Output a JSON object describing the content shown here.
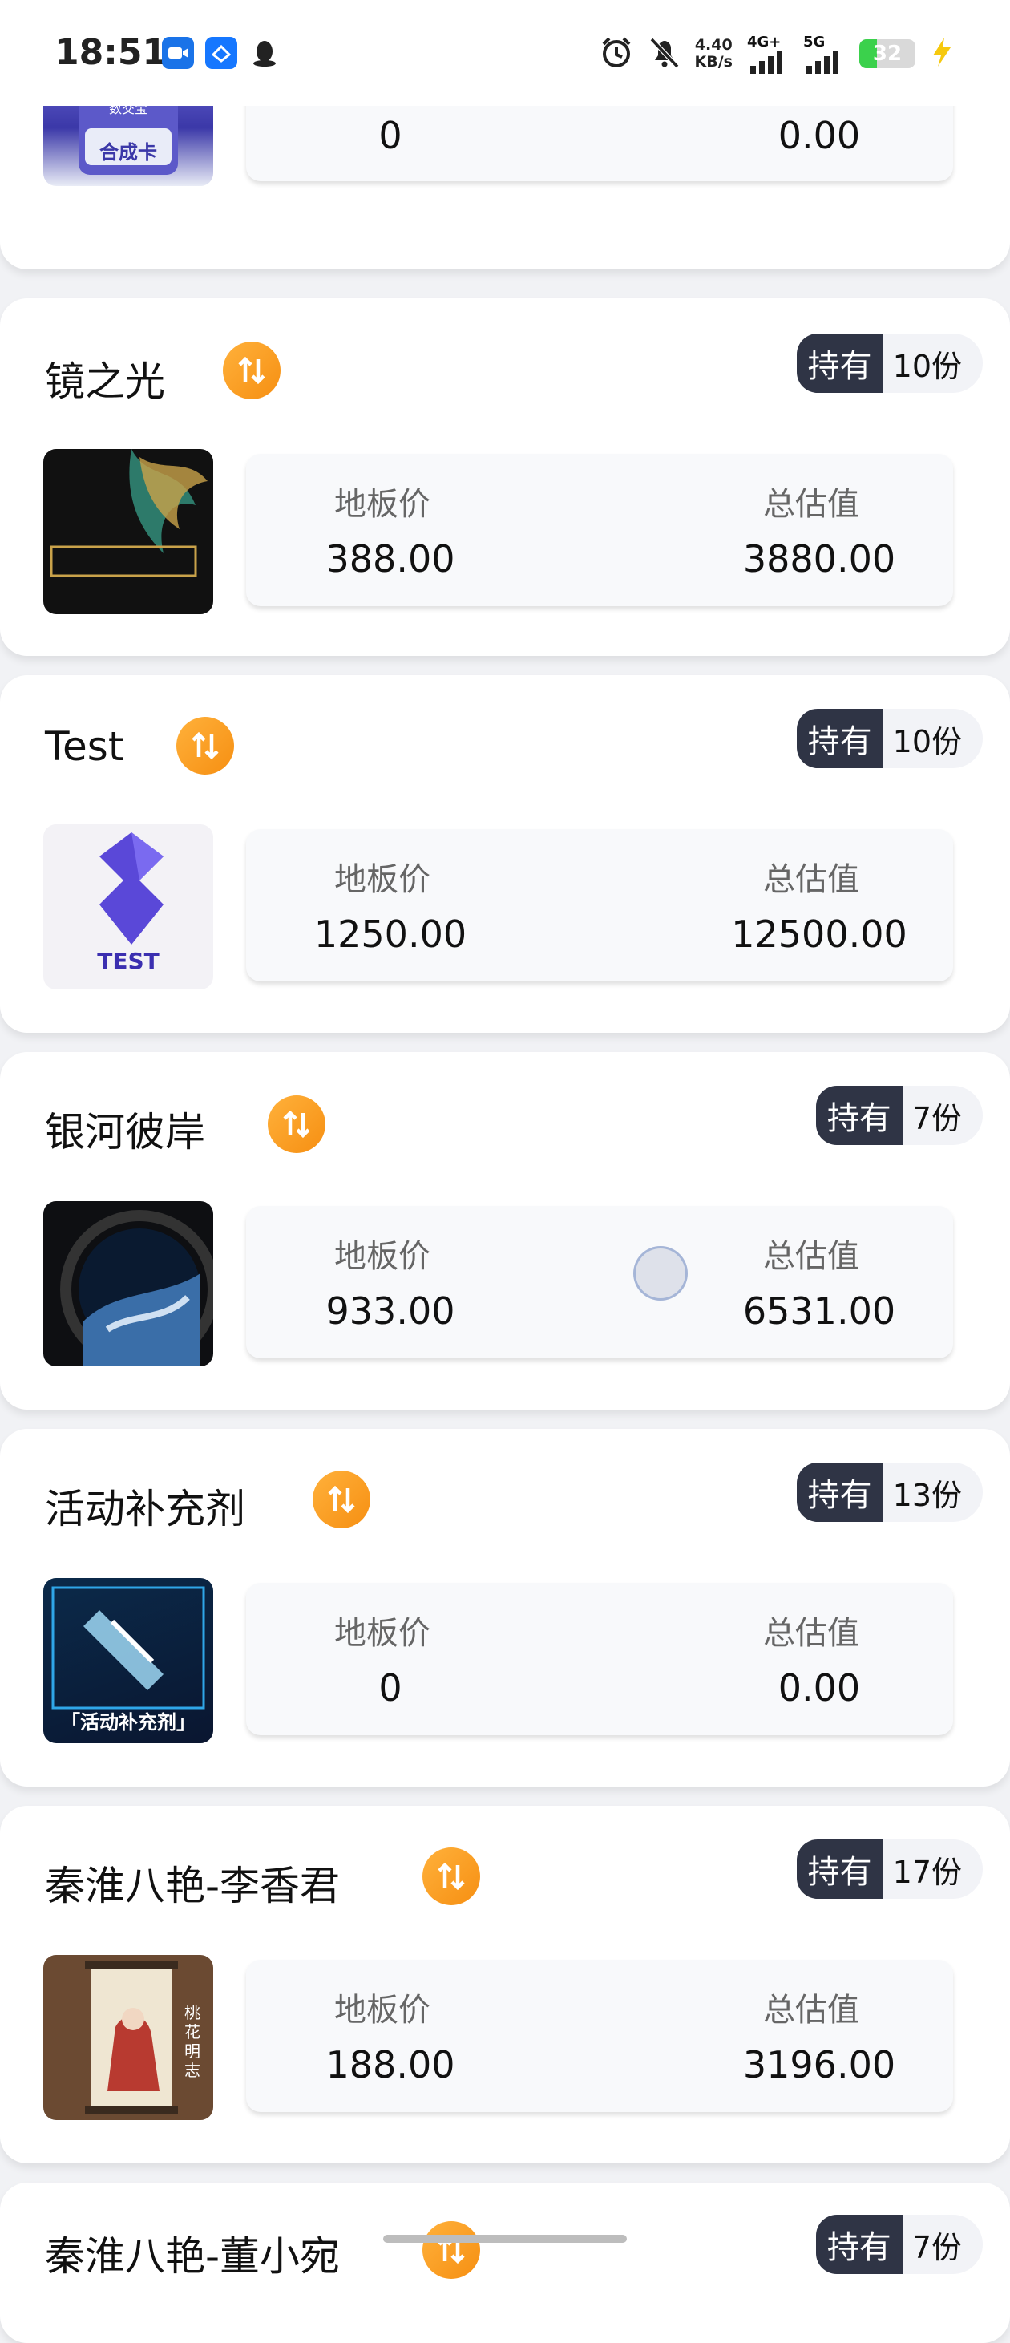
{
  "status_bar": {
    "time": "18:51",
    "net_speed": "4.40",
    "net_unit": "KB/s",
    "signal1": "4G+",
    "signal2": "5G",
    "battery": "32"
  },
  "labels": {
    "floor_price": "地板价",
    "total_value": "总估值",
    "hold": "持有"
  },
  "cards": [
    {
      "floor": "0",
      "total": "0.00",
      "thumb_caption": "合成卡",
      "thumb_top": "数交宝"
    },
    {
      "name": "镜之光",
      "count": "10份",
      "floor": "388.00",
      "total": "3880.00"
    },
    {
      "name": "Test",
      "count": "10份",
      "floor": "1250.00",
      "total": "12500.00",
      "thumb_caption": "TEST"
    },
    {
      "name": "银河彼岸",
      "count": "7份",
      "floor": "933.00",
      "total": "6531.00"
    },
    {
      "name": "活动补充剂",
      "count": "13份",
      "floor": "0",
      "total": "0.00",
      "thumb_caption": "「活动补充剂」"
    },
    {
      "name": "秦淮八艳-李香君",
      "count": "17份",
      "floor": "188.00",
      "total": "3196.00",
      "thumb_caption": "桃花明志"
    },
    {
      "name": "秦淮八艳-董小宛",
      "count": "7份"
    }
  ]
}
